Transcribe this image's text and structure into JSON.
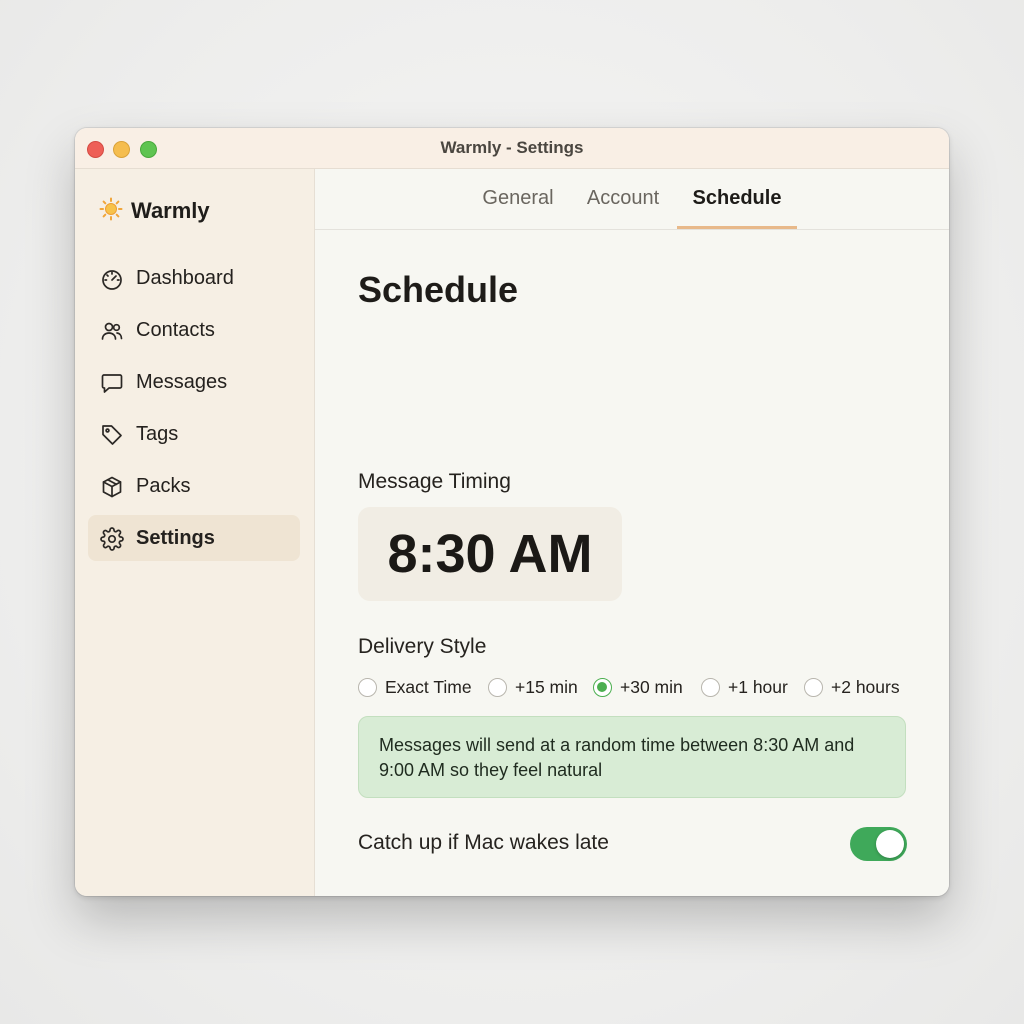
{
  "window": {
    "title": "Warmly - Settings"
  },
  "sidebar": {
    "brand": "Warmly",
    "brand_icon": "sun-icon",
    "items": [
      {
        "label": "Dashboard",
        "icon": "speedometer-icon"
      },
      {
        "label": "Contacts",
        "icon": "users-icon"
      },
      {
        "label": "Messages",
        "icon": "chat-bubble-icon"
      },
      {
        "label": "Tags",
        "icon": "tag-icon"
      },
      {
        "label": "Packs",
        "icon": "box-icon"
      },
      {
        "label": "Settings",
        "icon": "gear-icon",
        "active": true
      }
    ]
  },
  "tabs": [
    {
      "label": "General"
    },
    {
      "label": "Account"
    },
    {
      "label": "Schedule",
      "active": true
    }
  ],
  "main": {
    "title": "Schedule",
    "message_timing_label": "Message Timing",
    "time_value": "8:30 AM",
    "delivery_style_label": "Delivery Style",
    "delivery_options": [
      {
        "label": "Exact Time",
        "checked": false
      },
      {
        "label": "+15 min",
        "checked": false
      },
      {
        "label": "+30 min",
        "checked": true
      },
      {
        "label": "+1 hour",
        "checked": false
      },
      {
        "label": "+2 hours",
        "checked": false
      }
    ],
    "info_text": "Messages will send at a random time between 8:30 AM and 9:00 AM so they feel natural",
    "catch_up_label": "Catch up if Mac wakes late",
    "catch_up_enabled": true
  },
  "colors": {
    "accent_green": "#3fa95a",
    "tab_underline": "#e8b98a",
    "info_background": "#d8ecd5",
    "sidebar_active": "#efe4d3"
  }
}
